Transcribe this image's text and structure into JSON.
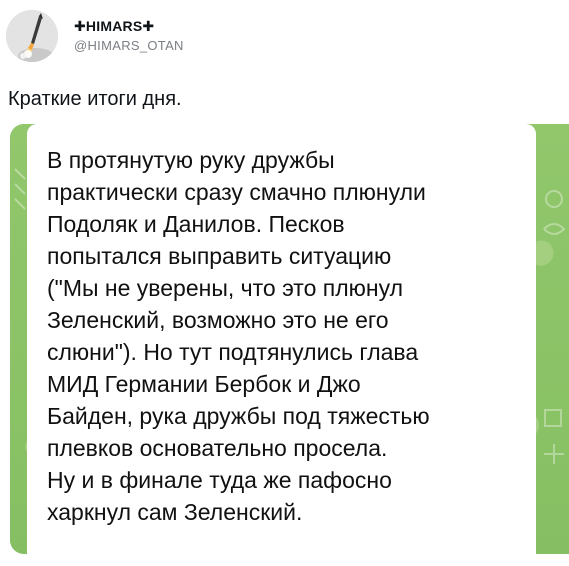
{
  "tweet": {
    "display_name": "✚HIMARS✚",
    "handle": "@HIMARS_OTAN",
    "text": "Краткие итоги дня."
  },
  "media": {
    "message_text": "В протянутую руку дружбы\nпрактически сразу смачно плюнули\nПодоляк и Данилов. Песков\nпопытался выправить ситуацию\n(\"Мы не уверены, что это плюнул\nЗеленский, возможно это не его\nслюни\"). Но тут подтянулись глава\nМИД Германии Бербок и Джо\nБайден, рука дружбы под тяжестью\nплевков основательно просела.\nНу и в финале туда же пафосно\nхаркнул сам Зеленский.",
    "background_color": "#8dc26a"
  },
  "icons": {
    "avatar": "rocket-launch-icon"
  }
}
